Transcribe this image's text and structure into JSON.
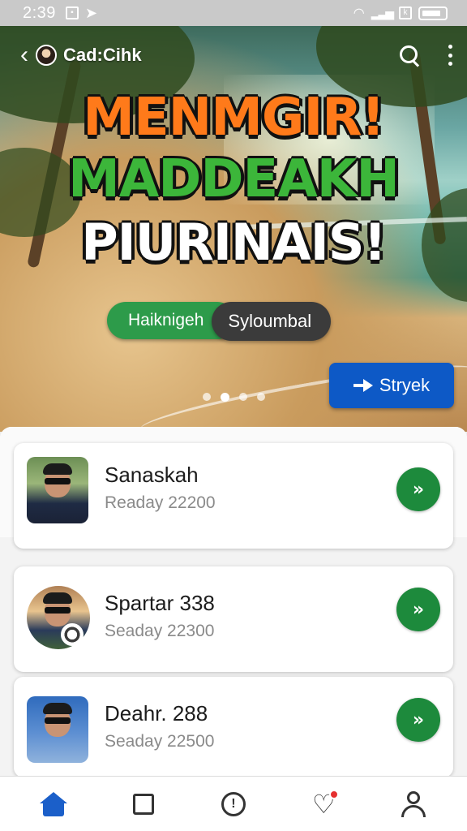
{
  "status_bar": {
    "time": "2:39",
    "icons": [
      "sim-icon",
      "send-icon",
      "wifi-icon",
      "signal-icon",
      "battery-icon"
    ]
  },
  "header": {
    "title": "Cad:Cihk",
    "icons": [
      "back-icon",
      "search-icon",
      "more-icon"
    ]
  },
  "hero": {
    "line1": "MENMGIR!",
    "line2": "MADDEAKH",
    "line3": "PIURINAIS!",
    "pill_green": "Haiknigeh",
    "pill_dark": "Syloumbal",
    "cta_label": "Stryek",
    "carousel": {
      "total": 4,
      "active": 2
    },
    "colors": {
      "line1": "#ff7a1a",
      "line2": "#3cb63a",
      "line3": "#ffffff",
      "cta": "#0d59c6",
      "pill_green": "#2d9b4a"
    }
  },
  "items": [
    {
      "title": "Sanaskah",
      "subtitle": "Readay 22200"
    },
    {
      "title": "Spartar 338",
      "subtitle": "Seaday 22300"
    },
    {
      "title": "Deahr. 288",
      "subtitle": "Seaday 22500"
    }
  ],
  "bottom_nav": {
    "items": [
      "home-icon",
      "square-icon",
      "alert-icon",
      "heart-icon",
      "user-icon"
    ],
    "active": "home-icon",
    "accent": "#1b5fc9",
    "badge_color": "#e53030"
  }
}
